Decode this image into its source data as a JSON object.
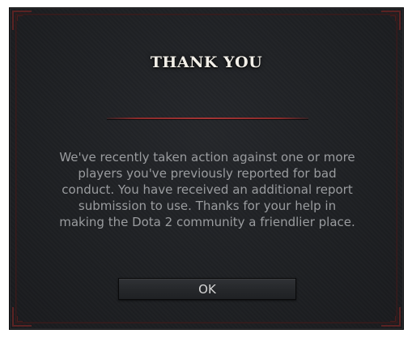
{
  "dialog": {
    "title": "THANK YOU",
    "message": "We've recently taken action against one or more players you've previously reported for bad conduct. You have received an additional report submission to use. Thanks for your help in making the Dota 2 community a friendlier place.",
    "ok_label": "OK"
  },
  "colors": {
    "background": "#1e2023",
    "frame_accent": "#5a2323",
    "divider": "#a33434",
    "title_text": "#f2efe8",
    "body_text": "#9a9c9f"
  }
}
